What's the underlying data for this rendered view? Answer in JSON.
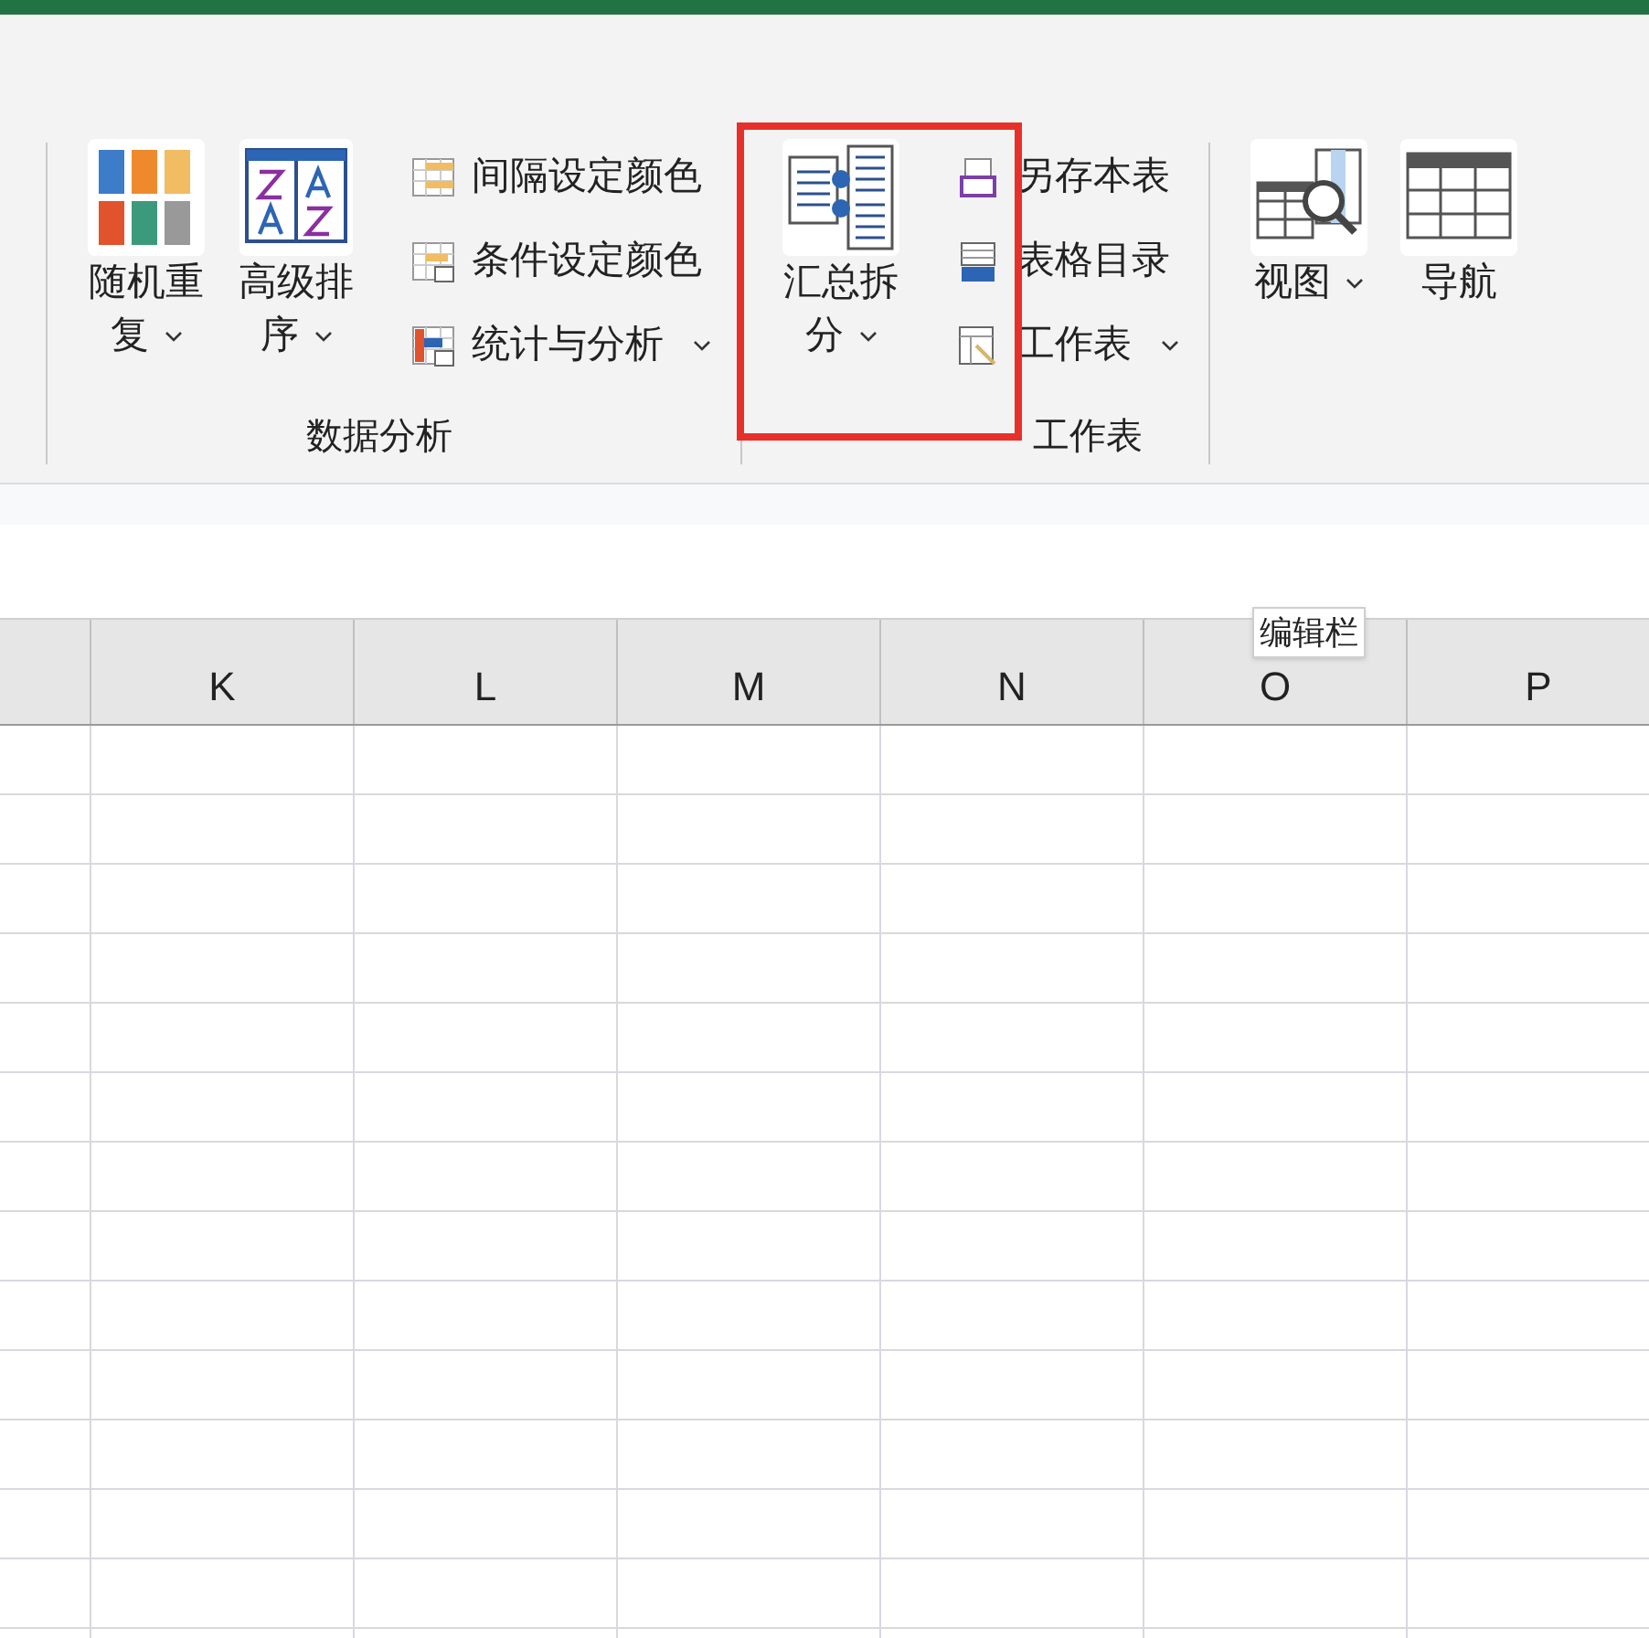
{
  "ribbon": {
    "groups": [
      {
        "label": "数据分析",
        "large_buttons": [
          {
            "label": "随机重复",
            "dropdown": true
          },
          {
            "label": "高级排序",
            "dropdown": true
          }
        ],
        "small_buttons": [
          {
            "label": "间隔设定颜色",
            "dropdown": false
          },
          {
            "label": "条件设定颜色",
            "dropdown": false
          },
          {
            "label": "统计与分析",
            "dropdown": true
          }
        ]
      },
      {
        "label": "工作表",
        "large_buttons": [
          {
            "label": "汇总拆分",
            "dropdown": true
          }
        ],
        "small_buttons": [
          {
            "label": "另存本表",
            "dropdown": false
          },
          {
            "label": "表格目录",
            "dropdown": false
          },
          {
            "label": "工作表",
            "dropdown": true
          }
        ]
      },
      {
        "large_buttons": [
          {
            "label": "视图",
            "dropdown": true
          },
          {
            "label": "导航",
            "dropdown": false
          }
        ]
      }
    ]
  },
  "columns": [
    "K",
    "L",
    "M",
    "N",
    "O",
    "P"
  ],
  "tooltip": "编辑栏"
}
